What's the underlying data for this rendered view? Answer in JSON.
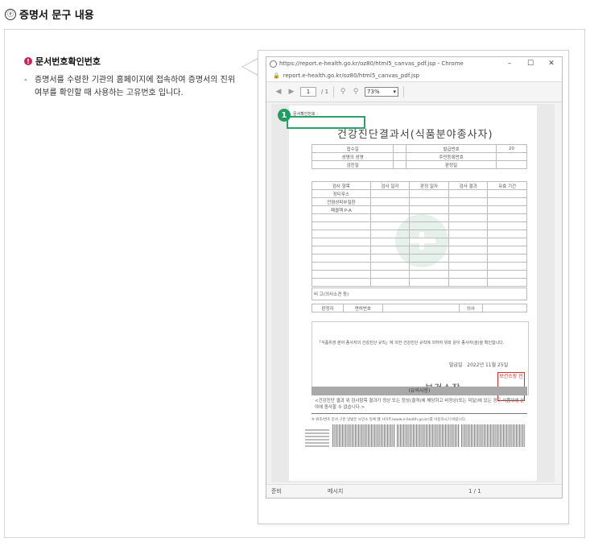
{
  "section": {
    "number_glyph": "ⓔ",
    "title": "증명서 문구 내용"
  },
  "info": {
    "icon": "exclamation-icon",
    "title": "문서번호확인번호",
    "dash": "-",
    "description": "증명서를 수령한 기관의 홈페이지에 접속하여 증명서의 진위여부를 확인할 때 사용하는 고유번호 입니다."
  },
  "browser": {
    "window_title": "https://report.e-health.go.kr/oz80/html5_canvas_pdf.jsp - Chrome",
    "address": "report.e-health.go.kr/oz80/html5_canvas_pdf.jsp",
    "controls": {
      "minimize": "–",
      "maximize": "☐",
      "close": "✕"
    },
    "toolbar": {
      "page_current": "1",
      "page_total": "/ 1",
      "zoom": "73%"
    },
    "status": {
      "left": "준비",
      "middle": "메시지",
      "right": "1 / 1"
    }
  },
  "callout": {
    "badge": "1"
  },
  "document": {
    "docno_label": "문서확인번호 :",
    "title": "건강진단결과서(식품분야종사자)",
    "rows": {
      "received": "접수일",
      "issue_no_label": "발급번호",
      "issue_no_value": "20",
      "name": "성명의 성명",
      "resident_no": "주민등록번호",
      "exam_date": "검진일",
      "judge_date": "판정일",
      "col_item": "검사 항목",
      "col_exam_date": "검사 일자",
      "col_judge_date": "판정 일자",
      "col_result": "검사 결과",
      "col_valid": "유효 기간",
      "item1": "장티푸스",
      "item2": "전염성피부질환",
      "item3": "폐결핵 P-A",
      "remarks": "비 고(의사소견 등)",
      "judge": "판정자",
      "license": "면허번호",
      "doctor": "의사"
    },
    "notice_line": "「식품위생 분야 종사자의 건강진단 규칙」에 의한 건강진단 규칙에 의하여 위와 같이 종사자(검)을 확인합니다.",
    "issue_date_label": "발급일",
    "issue_date": "2022년 11월 25일",
    "issuer": "보건소장",
    "seal_text": "보건소장 인",
    "appendix_title": "(유의사항)",
    "appendix_text": "<건강진단 결과 위 검사항목 결과가 정상 또는 정상(결격)에 해당하고 비정상(또는 미달)에 있는 경우 식품위생 분야에 종사할 수 없습니다.>",
    "footnote": "※ 위조/변조 문서 구분 방법은 보건소 등록 웹 사이트(www.e-health.go.kr)를 이용하시기 바랍니다."
  }
}
